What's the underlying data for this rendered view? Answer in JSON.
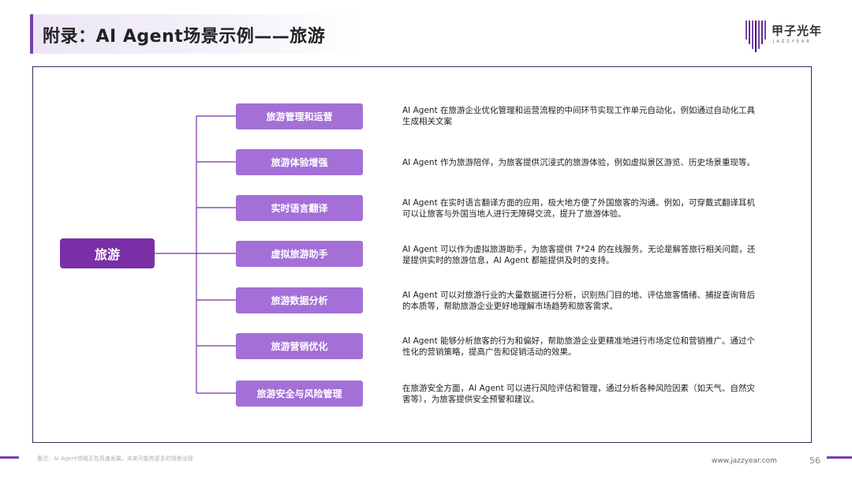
{
  "header": {
    "title": "附录：AI Agent场景示例——旅游"
  },
  "logo": {
    "name": "甲子光年",
    "subtitle": "JAZZYEAR",
    "icon": "jazzyear-logo-icon"
  },
  "diagram": {
    "root": "旅游",
    "branches": [
      {
        "label": "旅游管理和运营",
        "description": "AI Agent 在旅游企业优化管理和运营流程的中间环节实现工作单元自动化，例如通过自动化工具生成相关文案"
      },
      {
        "label": "旅游体验增强",
        "description": "AI Agent 作为旅游陪伴，为旅客提供沉浸式的旅游体验，例如虚拟景区游览、历史场景重现等。"
      },
      {
        "label": "实时语言翻译",
        "description": "AI Agent 在实时语言翻译方面的应用，极大地方便了外国旅客的沟通。例如，可穿戴式翻译耳机可以让旅客与外国当地人进行无障碍交流，提升了旅游体验。"
      },
      {
        "label": "虚拟旅游助手",
        "description": "AI Agent 可以作为虚拟旅游助手，为旅客提供 7*24 的在线服务。无论是解答旅行相关问题，还是提供实时的旅游信息，AI Agent 都能提供及时的支持。"
      },
      {
        "label": "旅游数据分析",
        "description": "AI Agent 可以对旅游行业的大量数据进行分析，识别热门目的地、评估旅客情绪、捕捉查询背后的本质等，帮助旅游企业更好地理解市场趋势和旅客需求。"
      },
      {
        "label": "旅游营销优化",
        "description": "AI Agent 能够分析旅客的行为和偏好，帮助旅游企业更精准地进行市场定位和营销推广。通过个性化的营销策略，提高广告和促销活动的效果。"
      },
      {
        "label": "旅游安全与风险管理",
        "description": "在旅游安全方面，AI Agent 可以进行风险评估和管理，通过分析各种风险因素（如天气、自然灾害等），为旅客提供安全预警和建议。"
      }
    ]
  },
  "footer": {
    "note": "备注：AI Agent领域正在高速发展，未来可能有更多的场景出现",
    "url": "www.jazzyear.com",
    "page": "56"
  },
  "colors": {
    "root": "#7b2fa6",
    "branch": "#a46fd7",
    "accent": "#7b3fb4",
    "frame": "#3a2a55"
  }
}
